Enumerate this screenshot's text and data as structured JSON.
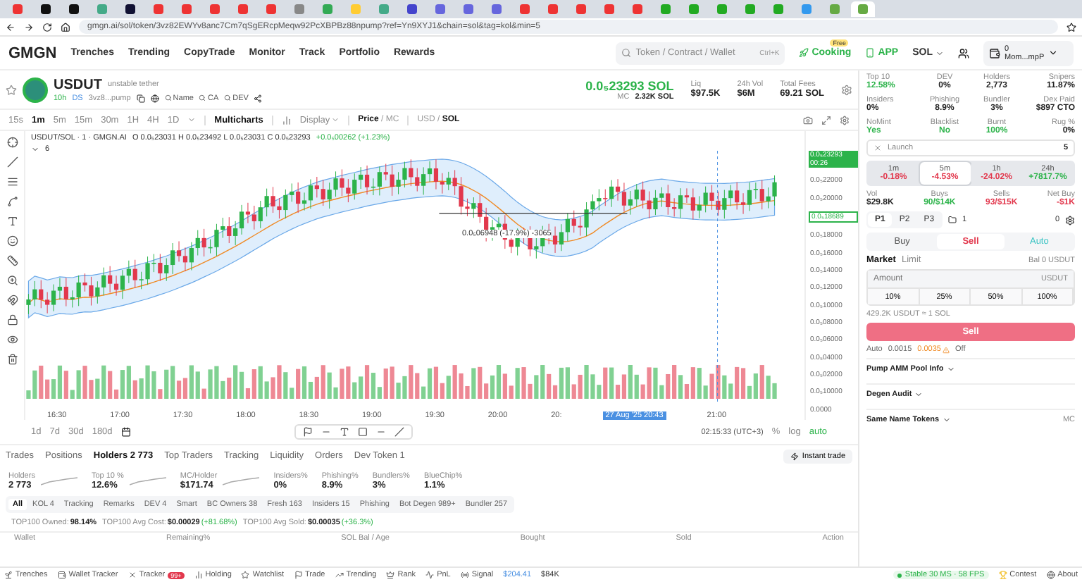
{
  "browser": {
    "tabs": [
      {
        "selected": false
      },
      {
        "selected": false
      },
      {
        "selected": false
      },
      {
        "selected": false
      },
      {
        "selected": false
      },
      {
        "selected": false
      },
      {
        "selected": false
      },
      {
        "selected": false
      },
      {
        "selected": false
      },
      {
        "selected": false
      },
      {
        "selected": false
      },
      {
        "selected": false
      },
      {
        "selected": false
      },
      {
        "selected": false
      },
      {
        "selected": false
      },
      {
        "selected": false
      },
      {
        "selected": false
      },
      {
        "selected": false
      },
      {
        "selected": false
      },
      {
        "selected": false
      },
      {
        "selected": false
      },
      {
        "selected": false
      },
      {
        "selected": false
      },
      {
        "selected": false
      },
      {
        "selected": false
      },
      {
        "selected": false
      },
      {
        "selected": false
      },
      {
        "selected": false
      },
      {
        "selected": false
      },
      {
        "selected": false
      },
      {
        "selected": true
      }
    ],
    "url": "gmgn.ai/sol/token/3vz82EWYv8anc7Cm7qSgERcpMeqw92PcXBPBz88npump?ref=Yn9XYJ1&chain=sol&tag=kol&min=5"
  },
  "nav": {
    "logo": "GMGN",
    "items": [
      "Trenches",
      "Trending",
      "CopyTrade",
      "Monitor",
      "Track",
      "Portfolio",
      "Rewards"
    ],
    "search": {
      "placeholder": "Token / Contract / Wallet",
      "shortcut": "Ctrl+K"
    },
    "cooking": "Cooking",
    "cooking_badge": "Free",
    "app": "APP",
    "chain": "SOL",
    "wallet_balance": "0",
    "wallet_address": "Mom...mpP"
  },
  "token": {
    "symbol": "USDUT",
    "name": "unstable tether",
    "age": "10h",
    "ds": "DS",
    "address": "3vz8...pump",
    "searches": [
      "Name",
      "CA",
      "DEV"
    ],
    "price": "0.0₅23293 SOL",
    "mc_label": "MC",
    "mc": "2.32K SOL",
    "metrics": [
      {
        "label": "Liq",
        "value": "$97.5K"
      },
      {
        "label": "24h Vol",
        "value": "$6M"
      },
      {
        "label": "Total Fees",
        "value": "69.21 SOL"
      }
    ]
  },
  "chart_toolbar": {
    "intervals": [
      {
        "label": "15s",
        "selected": false
      },
      {
        "label": "1m",
        "selected": true
      },
      {
        "label": "5m",
        "selected": false
      },
      {
        "label": "15m",
        "selected": false
      },
      {
        "label": "30m",
        "selected": false
      },
      {
        "label": "1H",
        "selected": false
      },
      {
        "label": "4H",
        "selected": false
      },
      {
        "label": "1D",
        "selected": false
      }
    ],
    "multicharts": "Multicharts",
    "display": "Display",
    "price_mode": "**Price** / MC",
    "currency": "USD / **SOL**"
  },
  "chart": {
    "legend": "USDUT/SOL · 1 · GMGN.AI",
    "ohlc": "O 0.0₅23031 H 0.0₅23492 L 0.0₅23031 C 0.0₅23293",
    "change": "+0.0₅00262 (+1.23%)",
    "indicator_count": "6",
    "marker": "0.0₅06948 (-17.9%) -3065",
    "last_price": "0.0₅23293",
    "countdown": "00:26",
    "line_price": "0.0₅18689",
    "price_ticks": [
      "0.0₅22000",
      "0.0₅20000",
      "0.0₅18000",
      "0.0₅16000",
      "0.0₅14000",
      "0.0₅12000",
      "0.0₅10000",
      "0.0₅08000",
      "0.0₅06000",
      "0.0₅04000",
      "0.0₅02000",
      "0.0₅10000",
      "0.0000"
    ],
    "time_ticks": [
      "16:30",
      "17:00",
      "17:30",
      "18:00",
      "18:30",
      "19:00",
      "19:30",
      "20:00",
      "20:"
    ],
    "cursor_time": "27 Aug '25  20:43",
    "end_time": "21:00",
    "ranges": [
      "1d",
      "7d",
      "30d",
      "180d"
    ],
    "clock": "02:15:33 (UTC+3)",
    "pct": "%",
    "log": "log",
    "auto": "auto"
  },
  "bottom": {
    "tabs": [
      {
        "label": "Trades",
        "selected": false
      },
      {
        "label": "Positions",
        "selected": false
      },
      {
        "label": "Holders 2 773",
        "selected": true
      },
      {
        "label": "Top Traders",
        "selected": false
      },
      {
        "label": "Tracking",
        "selected": false
      },
      {
        "label": "Liquidity",
        "selected": false
      },
      {
        "label": "Orders",
        "selected": false
      },
      {
        "label": "Dev Token 1",
        "selected": false
      }
    ],
    "instant_trade": "Instant trade",
    "stats": [
      {
        "label": "Holders",
        "value": "2 773",
        "spark": true
      },
      {
        "label": "Top 10 %",
        "value": "12.6%",
        "spark": true
      },
      {
        "label": "MC/Holder",
        "value": "$171.74",
        "spark": true
      },
      {
        "label": "Insiders%",
        "value": "0%",
        "spark": false
      },
      {
        "label": "Phishing%",
        "value": "8.9%",
        "spark": false
      },
      {
        "label": "Bundlers%",
        "value": "3%",
        "spark": false
      },
      {
        "label": "BlueChip%",
        "value": "1.1%",
        "spark": false
      }
    ],
    "filters": [
      {
        "label": "All",
        "selected": true
      },
      {
        "label": "KOL 4",
        "selected": false
      },
      {
        "label": "Tracking",
        "selected": false
      },
      {
        "label": "Remarks",
        "selected": false
      },
      {
        "label": "DEV 4",
        "selected": false
      },
      {
        "label": "Smart",
        "selected": false
      },
      {
        "label": "BC Owners 38",
        "selected": false
      },
      {
        "label": "Fresh 163",
        "selected": false
      },
      {
        "label": "Insiders 15",
        "selected": false
      },
      {
        "label": "Phishing",
        "selected": false
      },
      {
        "label": "Bot Degen 989+",
        "selected": false
      },
      {
        "label": "Bundler 257",
        "selected": false
      }
    ],
    "summary": [
      {
        "label": "TOP100 Owned:",
        "value": "98.14%"
      },
      {
        "label": "TOP100 Avg Cost:",
        "value": "$0.00029",
        "change": "(+81.68%)"
      },
      {
        "label": "TOP100 Avg Sold:",
        "value": "$0.00035",
        "change": "(+36.3%)"
      }
    ],
    "columns": [
      "Wallet",
      "Remaining%",
      "SOL Bal / Age",
      "Bought",
      "Sold",
      "Action"
    ]
  },
  "side": {
    "stats": [
      {
        "label": "Top 10",
        "value": "12.58%",
        "color": "#2cb34a"
      },
      {
        "label": "DEV",
        "value": "0%",
        "color": "#222222"
      },
      {
        "label": "Holders",
        "value": "2,773",
        "color": "#222222"
      },
      {
        "label": "Snipers",
        "value": "11.87%",
        "color": "#222222"
      },
      {
        "label": "Insiders",
        "value": "0%",
        "color": "#222222"
      },
      {
        "label": "Phishing",
        "value": "8.9%",
        "color": "#222222"
      },
      {
        "label": "Bundler",
        "value": "3%",
        "color": "#222222"
      },
      {
        "label": "Dex Paid",
        "value": "$897 CTO",
        "color": "#222222"
      },
      {
        "label": "NoMint",
        "value": "Yes",
        "color": "#2cb34a"
      },
      {
        "label": "Blacklist",
        "value": "No",
        "color": "#2cb34a"
      },
      {
        "label": "Burnt",
        "value": "100%",
        "color": "#2cb34a"
      },
      {
        "label": "Rug %",
        "value": "0%",
        "color": "#222222"
      }
    ],
    "launch": "Launch",
    "launch_count": "5",
    "periods": [
      {
        "label": "1m",
        "value": "-0.18%",
        "color": "#e2384d",
        "selected": false
      },
      {
        "label": "5m",
        "value": "-4.53%",
        "color": "#e2384d",
        "selected": true
      },
      {
        "label": "1h",
        "value": "-24.02%",
        "color": "#e2384d",
        "selected": false
      },
      {
        "label": "24h",
        "value": "+7817.7%",
        "color": "#2cb34a",
        "selected": false
      }
    ],
    "flow": [
      {
        "label": "Vol",
        "value": "$29.8K",
        "color": "#222222"
      },
      {
        "label": "Buys",
        "value": "90/$14K",
        "color": "#2cb34a"
      },
      {
        "label": "Sells",
        "value": "93/$15K",
        "color": "#e2384d"
      },
      {
        "label": "Net Buy",
        "value": "-$1K",
        "color": "#e2384d"
      }
    ],
    "presets": [
      {
        "label": "P1",
        "selected": true
      },
      {
        "label": "P2",
        "selected": false
      },
      {
        "label": "P3",
        "selected": false
      }
    ],
    "folder_count": "1",
    "pending": "0",
    "sides": [
      {
        "label": "Buy",
        "selected": false
      },
      {
        "label": "Sell",
        "selected": true
      },
      {
        "label": "Auto",
        "selected": false
      }
    ],
    "order_types": [
      {
        "label": "Market",
        "selected": true
      },
      {
        "label": "Limit",
        "selected": false
      }
    ],
    "balance": "Bal 0 USDUT",
    "amount": {
      "placeholder": "Amount",
      "unit": "USDUT"
    },
    "quick": [
      "10%",
      "25%",
      "50%",
      "100%"
    ],
    "rate": "429.2K USDUT ≈ 1 SOL",
    "submit": "Sell",
    "fees": [
      {
        "label": "Auto",
        "warn": false
      },
      {
        "label": "0.0015",
        "warn": false
      },
      {
        "label": "0.0035",
        "warn": true
      },
      {
        "label": "Off",
        "warn": false
      }
    ],
    "sections": [
      {
        "title": "Pump AMM Pool Info"
      },
      {
        "title": "Degen Audit"
      },
      {
        "title": "Same Name Tokens",
        "extra": "MC"
      }
    ]
  },
  "footer": {
    "items": [
      "Trenches",
      "Wallet Tracker",
      "Tracker",
      "Holding",
      "Watchlist",
      "Trade",
      "Trending",
      "Rank",
      "PnL",
      "Signal"
    ],
    "tracker_badge": "99+",
    "balance": "$204.41",
    "sol_price": "$84K",
    "status": "Stable 30 MS · 58 FPS",
    "contest": "Contest",
    "about": "About"
  }
}
